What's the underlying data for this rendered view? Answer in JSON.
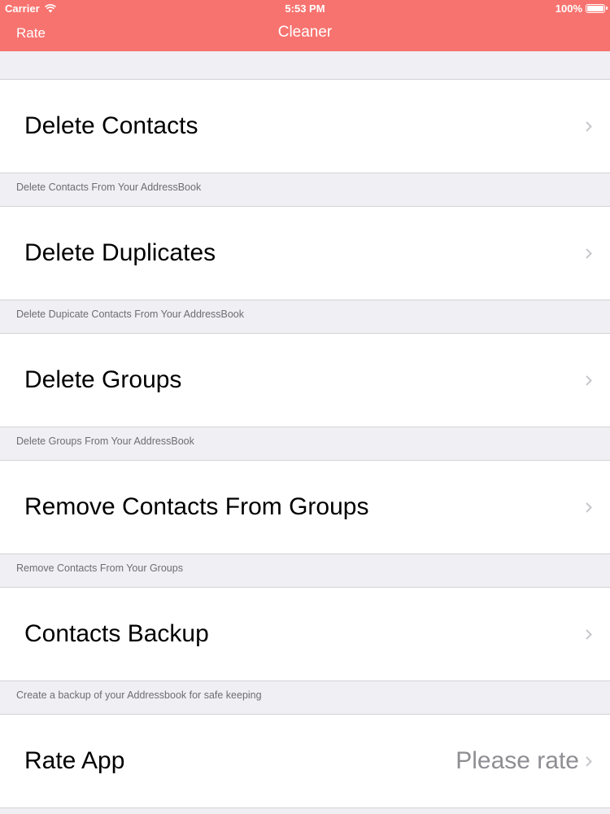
{
  "status_bar": {
    "carrier": "Carrier",
    "time": "5:53 PM",
    "battery": "100%"
  },
  "nav": {
    "left_button": "Rate",
    "title": "Cleaner"
  },
  "colors": {
    "nav_background": "#f7736f",
    "page_background": "#efeff4"
  },
  "rows": [
    {
      "title": "Delete Contacts",
      "footer": "Delete Contacts From Your AddressBook",
      "detail": ""
    },
    {
      "title": "Delete Duplicates",
      "footer": "Delete Dupicate Contacts From Your AddressBook",
      "detail": ""
    },
    {
      "title": "Delete Groups",
      "footer": "Delete Groups From Your AddressBook",
      "detail": ""
    },
    {
      "title": "Remove Contacts From Groups",
      "footer": "Remove Contacts From Your Groups",
      "detail": ""
    },
    {
      "title": "Contacts Backup",
      "footer": "Create a backup of your Addressbook for safe keeping",
      "detail": ""
    },
    {
      "title": "Rate App",
      "footer": "",
      "detail": "Please rate"
    }
  ]
}
